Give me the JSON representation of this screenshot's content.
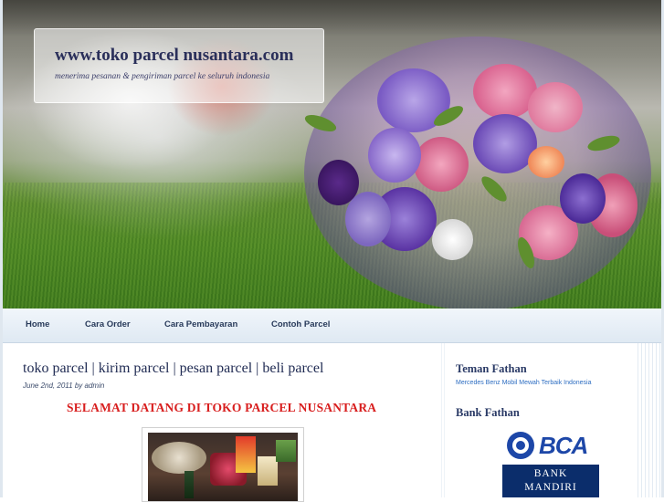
{
  "header": {
    "site_title": "www.toko parcel nusantara.com",
    "tagline": "menerima pesanan & pengiriman parcel ke seluruh indonesia"
  },
  "nav": {
    "items": [
      {
        "label": "Home"
      },
      {
        "label": "Cara Order"
      },
      {
        "label": "Cara Pembayaran"
      },
      {
        "label": "Contoh Parcel"
      }
    ]
  },
  "post": {
    "title": "toko parcel | kirim parcel | pesan parcel | beli parcel",
    "date": "June 2nd, 2011",
    "author_prefix": "by",
    "author": "admin",
    "heading": "SELAMAT DATANG DI TOKO PARCEL NUSANTARA"
  },
  "sidebar": {
    "widget1": {
      "title": "Teman Fathan",
      "link": "Mercedes Benz Mobil Mewah Terbaik Indonesia"
    },
    "widget2": {
      "title": "Bank Fathan",
      "bca_label": "BCA",
      "mandiri_line1": "BANK",
      "mandiri_line2": "MANDIRI"
    }
  },
  "colors": {
    "title_text": "#2a2f5a",
    "nav_text": "#283a5a",
    "heading_red": "#d81e1e",
    "link_blue": "#2e6ec2",
    "bca_blue": "#1d47a8",
    "mandiri_navy": "#0b2d6b"
  }
}
